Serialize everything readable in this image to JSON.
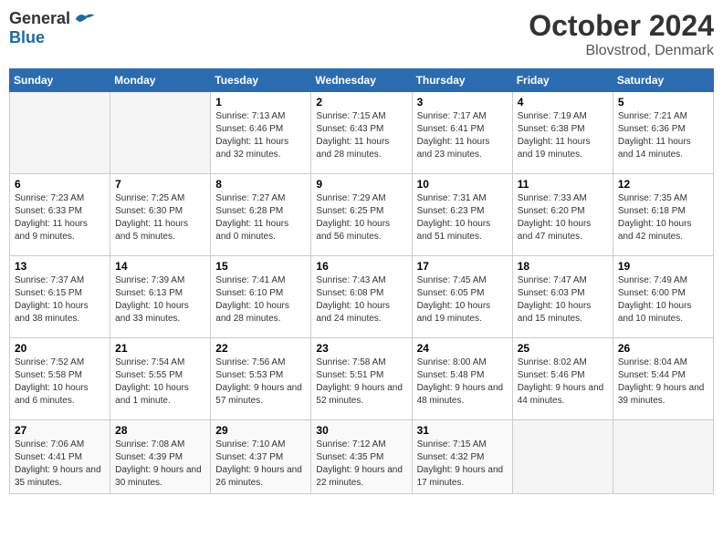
{
  "logo": {
    "general": "General",
    "blue": "Blue"
  },
  "title": {
    "month": "October 2024",
    "location": "Blovstrod, Denmark"
  },
  "weekdays": [
    "Sunday",
    "Monday",
    "Tuesday",
    "Wednesday",
    "Thursday",
    "Friday",
    "Saturday"
  ],
  "weeks": [
    [
      {
        "day": "",
        "sunrise": "",
        "sunset": "",
        "daylight": "",
        "empty": true
      },
      {
        "day": "",
        "sunrise": "",
        "sunset": "",
        "daylight": "",
        "empty": true
      },
      {
        "day": "1",
        "sunrise": "Sunrise: 7:13 AM",
        "sunset": "Sunset: 6:46 PM",
        "daylight": "Daylight: 11 hours and 32 minutes.",
        "empty": false
      },
      {
        "day": "2",
        "sunrise": "Sunrise: 7:15 AM",
        "sunset": "Sunset: 6:43 PM",
        "daylight": "Daylight: 11 hours and 28 minutes.",
        "empty": false
      },
      {
        "day": "3",
        "sunrise": "Sunrise: 7:17 AM",
        "sunset": "Sunset: 6:41 PM",
        "daylight": "Daylight: 11 hours and 23 minutes.",
        "empty": false
      },
      {
        "day": "4",
        "sunrise": "Sunrise: 7:19 AM",
        "sunset": "Sunset: 6:38 PM",
        "daylight": "Daylight: 11 hours and 19 minutes.",
        "empty": false
      },
      {
        "day": "5",
        "sunrise": "Sunrise: 7:21 AM",
        "sunset": "Sunset: 6:36 PM",
        "daylight": "Daylight: 11 hours and 14 minutes.",
        "empty": false
      }
    ],
    [
      {
        "day": "6",
        "sunrise": "Sunrise: 7:23 AM",
        "sunset": "Sunset: 6:33 PM",
        "daylight": "Daylight: 11 hours and 9 minutes.",
        "empty": false
      },
      {
        "day": "7",
        "sunrise": "Sunrise: 7:25 AM",
        "sunset": "Sunset: 6:30 PM",
        "daylight": "Daylight: 11 hours and 5 minutes.",
        "empty": false
      },
      {
        "day": "8",
        "sunrise": "Sunrise: 7:27 AM",
        "sunset": "Sunset: 6:28 PM",
        "daylight": "Daylight: 11 hours and 0 minutes.",
        "empty": false
      },
      {
        "day": "9",
        "sunrise": "Sunrise: 7:29 AM",
        "sunset": "Sunset: 6:25 PM",
        "daylight": "Daylight: 10 hours and 56 minutes.",
        "empty": false
      },
      {
        "day": "10",
        "sunrise": "Sunrise: 7:31 AM",
        "sunset": "Sunset: 6:23 PM",
        "daylight": "Daylight: 10 hours and 51 minutes.",
        "empty": false
      },
      {
        "day": "11",
        "sunrise": "Sunrise: 7:33 AM",
        "sunset": "Sunset: 6:20 PM",
        "daylight": "Daylight: 10 hours and 47 minutes.",
        "empty": false
      },
      {
        "day": "12",
        "sunrise": "Sunrise: 7:35 AM",
        "sunset": "Sunset: 6:18 PM",
        "daylight": "Daylight: 10 hours and 42 minutes.",
        "empty": false
      }
    ],
    [
      {
        "day": "13",
        "sunrise": "Sunrise: 7:37 AM",
        "sunset": "Sunset: 6:15 PM",
        "daylight": "Daylight: 10 hours and 38 minutes.",
        "empty": false
      },
      {
        "day": "14",
        "sunrise": "Sunrise: 7:39 AM",
        "sunset": "Sunset: 6:13 PM",
        "daylight": "Daylight: 10 hours and 33 minutes.",
        "empty": false
      },
      {
        "day": "15",
        "sunrise": "Sunrise: 7:41 AM",
        "sunset": "Sunset: 6:10 PM",
        "daylight": "Daylight: 10 hours and 28 minutes.",
        "empty": false
      },
      {
        "day": "16",
        "sunrise": "Sunrise: 7:43 AM",
        "sunset": "Sunset: 6:08 PM",
        "daylight": "Daylight: 10 hours and 24 minutes.",
        "empty": false
      },
      {
        "day": "17",
        "sunrise": "Sunrise: 7:45 AM",
        "sunset": "Sunset: 6:05 PM",
        "daylight": "Daylight: 10 hours and 19 minutes.",
        "empty": false
      },
      {
        "day": "18",
        "sunrise": "Sunrise: 7:47 AM",
        "sunset": "Sunset: 6:03 PM",
        "daylight": "Daylight: 10 hours and 15 minutes.",
        "empty": false
      },
      {
        "day": "19",
        "sunrise": "Sunrise: 7:49 AM",
        "sunset": "Sunset: 6:00 PM",
        "daylight": "Daylight: 10 hours and 10 minutes.",
        "empty": false
      }
    ],
    [
      {
        "day": "20",
        "sunrise": "Sunrise: 7:52 AM",
        "sunset": "Sunset: 5:58 PM",
        "daylight": "Daylight: 10 hours and 6 minutes.",
        "empty": false
      },
      {
        "day": "21",
        "sunrise": "Sunrise: 7:54 AM",
        "sunset": "Sunset: 5:55 PM",
        "daylight": "Daylight: 10 hours and 1 minute.",
        "empty": false
      },
      {
        "day": "22",
        "sunrise": "Sunrise: 7:56 AM",
        "sunset": "Sunset: 5:53 PM",
        "daylight": "Daylight: 9 hours and 57 minutes.",
        "empty": false
      },
      {
        "day": "23",
        "sunrise": "Sunrise: 7:58 AM",
        "sunset": "Sunset: 5:51 PM",
        "daylight": "Daylight: 9 hours and 52 minutes.",
        "empty": false
      },
      {
        "day": "24",
        "sunrise": "Sunrise: 8:00 AM",
        "sunset": "Sunset: 5:48 PM",
        "daylight": "Daylight: 9 hours and 48 minutes.",
        "empty": false
      },
      {
        "day": "25",
        "sunrise": "Sunrise: 8:02 AM",
        "sunset": "Sunset: 5:46 PM",
        "daylight": "Daylight: 9 hours and 44 minutes.",
        "empty": false
      },
      {
        "day": "26",
        "sunrise": "Sunrise: 8:04 AM",
        "sunset": "Sunset: 5:44 PM",
        "daylight": "Daylight: 9 hours and 39 minutes.",
        "empty": false
      }
    ],
    [
      {
        "day": "27",
        "sunrise": "Sunrise: 7:06 AM",
        "sunset": "Sunset: 4:41 PM",
        "daylight": "Daylight: 9 hours and 35 minutes.",
        "empty": false
      },
      {
        "day": "28",
        "sunrise": "Sunrise: 7:08 AM",
        "sunset": "Sunset: 4:39 PM",
        "daylight": "Daylight: 9 hours and 30 minutes.",
        "empty": false
      },
      {
        "day": "29",
        "sunrise": "Sunrise: 7:10 AM",
        "sunset": "Sunset: 4:37 PM",
        "daylight": "Daylight: 9 hours and 26 minutes.",
        "empty": false
      },
      {
        "day": "30",
        "sunrise": "Sunrise: 7:12 AM",
        "sunset": "Sunset: 4:35 PM",
        "daylight": "Daylight: 9 hours and 22 minutes.",
        "empty": false
      },
      {
        "day": "31",
        "sunrise": "Sunrise: 7:15 AM",
        "sunset": "Sunset: 4:32 PM",
        "daylight": "Daylight: 9 hours and 17 minutes.",
        "empty": false
      },
      {
        "day": "",
        "sunrise": "",
        "sunset": "",
        "daylight": "",
        "empty": true
      },
      {
        "day": "",
        "sunrise": "",
        "sunset": "",
        "daylight": "",
        "empty": true
      }
    ]
  ]
}
